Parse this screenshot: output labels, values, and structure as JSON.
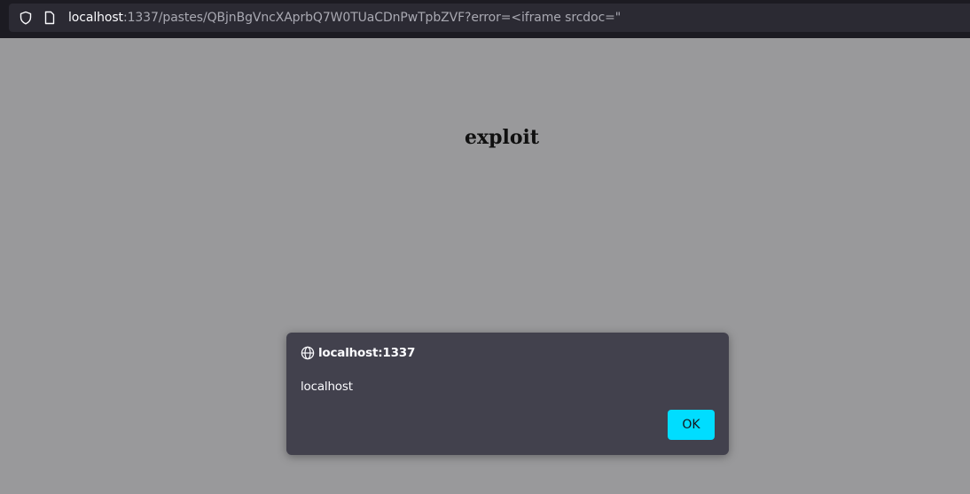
{
  "browser": {
    "url_host": "localhost",
    "url_rest": ":1337/pastes/QBjnBgVncXAprbQ7W0TUaCDnPwTpbZVF?error=<iframe srcdoc=\"",
    "shield_icon": "shield-icon",
    "page_icon": "page-icon"
  },
  "page": {
    "heading": "exploit"
  },
  "dialog": {
    "title": "localhost:1337",
    "message": "localhost",
    "ok_label": "OK",
    "globe_icon": "globe-icon",
    "accent_color": "#00ddff",
    "background_color": "#42414d"
  },
  "colors": {
    "overlay": "#99999b",
    "toolbar": "#1c1b22",
    "urlbar": "#2b2a33"
  }
}
